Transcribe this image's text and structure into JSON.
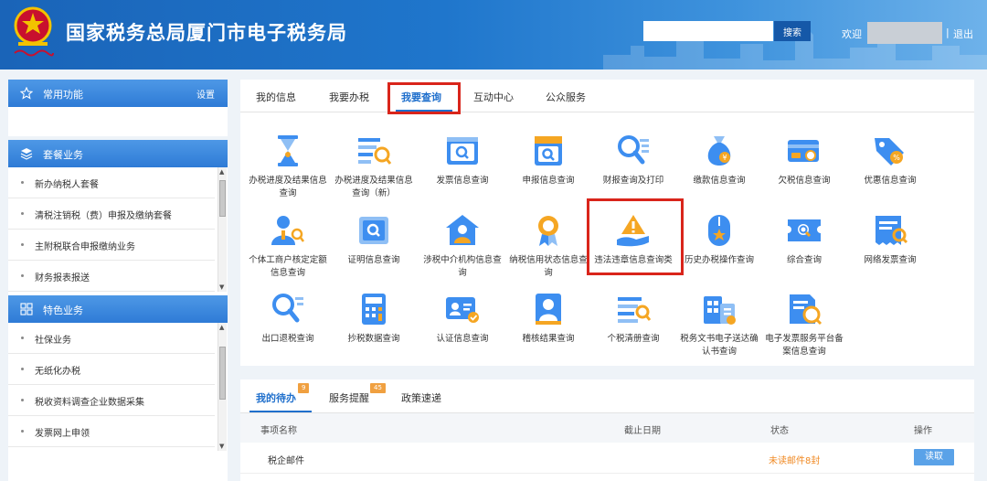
{
  "header": {
    "site_title": "国家税务总局厦门市电子税务局",
    "search_placeholder": "",
    "search_button": "搜索",
    "welcome": "欢迎",
    "separator": "|",
    "logout": "退出"
  },
  "sidebar": {
    "favorites": {
      "title": "常用功能",
      "settings": "设置",
      "icon": "star-icon"
    },
    "packages": {
      "title": "套餐业务",
      "icon": "layers-icon",
      "items": [
        "新办纳税人套餐",
        "清税注销税（费）申报及缴纳套餐",
        "主附税联合申报缴纳业务",
        "财务报表报送"
      ]
    },
    "features": {
      "title": "特色业务",
      "icon": "grid-icon",
      "items": [
        "社保业务",
        "无纸化办税",
        "税收资料调查企业数据采集",
        "发票网上申领"
      ]
    }
  },
  "main": {
    "tabs": [
      "我的信息",
      "我要办税",
      "我要查询",
      "互动中心",
      "公众服务"
    ],
    "active_tab": "我要查询",
    "tiles": [
      {
        "label": "办税进度及结果信息查询",
        "icon": "hourglass-icon"
      },
      {
        "label": "办税进度及结果信息查询（新）",
        "icon": "list-search-icon"
      },
      {
        "label": "发票信息查询",
        "icon": "invoice-search-icon"
      },
      {
        "label": "申报信息查询",
        "icon": "declaration-search-icon"
      },
      {
        "label": "财报查询及打印",
        "icon": "magnifier-list-icon"
      },
      {
        "label": "缴款信息查询",
        "icon": "money-bag-icon"
      },
      {
        "label": "欠税信息查询",
        "icon": "card-search-icon"
      },
      {
        "label": "优惠信息查询",
        "icon": "discount-tag-icon"
      },
      {
        "label": "个体工商户核定定额信息查询",
        "icon": "person-search-icon"
      },
      {
        "label": "证明信息查询",
        "icon": "certificate-search-icon"
      },
      {
        "label": "涉税中介机构信息查询",
        "icon": "house-person-icon"
      },
      {
        "label": "纳税信用状态信息查询",
        "icon": "medal-icon"
      },
      {
        "label": "违法违章信息查询类",
        "icon": "warning-hand-icon"
      },
      {
        "label": "历史办税操作查询",
        "icon": "history-mouse-icon"
      },
      {
        "label": "综合查询",
        "icon": "ticket-search-icon"
      },
      {
        "label": "网络发票查询",
        "icon": "e-invoice-icon"
      },
      {
        "label": "出口退税查询",
        "icon": "export-search-icon"
      },
      {
        "label": "抄税数据查询",
        "icon": "calculator-icon"
      },
      {
        "label": "认证信息查询",
        "icon": "id-verify-icon"
      },
      {
        "label": "稽核结果查询",
        "icon": "audit-person-icon"
      },
      {
        "label": "个税清册查询",
        "icon": "tax-list-icon"
      },
      {
        "label": "税务文书电子送达确认书查询",
        "icon": "document-building-icon"
      },
      {
        "label": "电子发票服务平台备案信息查询",
        "icon": "e-invoice-platform-icon"
      }
    ]
  },
  "bottom": {
    "tabs": [
      {
        "label": "我的待办",
        "badge": "9"
      },
      {
        "label": "服务提醒",
        "badge": "45"
      },
      {
        "label": "政策速递",
        "badge": ""
      }
    ],
    "columns": [
      "事项名称",
      "截止日期",
      "状态",
      "操作"
    ],
    "rows": [
      {
        "name": "税企邮件",
        "deadline": "",
        "status": "未读邮件8封",
        "action": "读取"
      }
    ]
  },
  "colors": {
    "primary": "#1f6fcc",
    "highlight": "#d9251b",
    "warning": "#f08a24"
  }
}
